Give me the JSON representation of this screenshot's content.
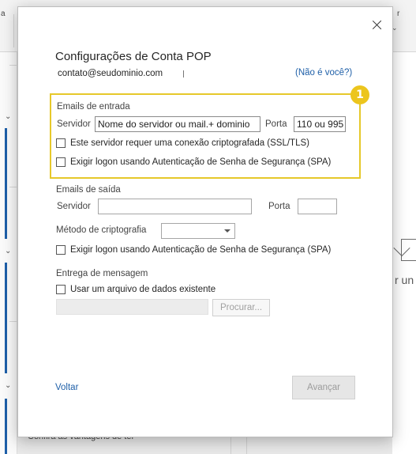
{
  "background": {
    "ribbon_letters": [
      "a",
      "r"
    ],
    "side_text": "r un",
    "bottom_text": "Confira as vantagens de ter"
  },
  "dialog": {
    "title": "Configurações de Conta POP",
    "email": "contato@seudominio.com",
    "not_you_link": "(Não é você?)",
    "badge_number": "1",
    "incoming": {
      "section_label": "Emails de entrada",
      "server_label": "Servidor",
      "server_value": "Nome do servidor ou mail.+ dominio",
      "port_label": "Porta",
      "port_value": "110 ou 995",
      "ssl_label": "Este servidor requer uma conexão criptografada (SSL/TLS)",
      "spa_label": "Exigir logon usando Autenticação de Senha de Segurança (SPA)"
    },
    "outgoing": {
      "section_label": "Emails de saída",
      "server_label": "Servidor",
      "server_value": "",
      "port_label": "Porta",
      "port_value": "",
      "encryption_label": "Método de criptografia",
      "encryption_value": "",
      "spa_label": "Exigir logon usando Autenticação de Senha de Segurança (SPA)"
    },
    "delivery": {
      "section_label": "Entrega de mensagem",
      "existing_file_label": "Usar um arquivo de dados existente",
      "browse_label": "Procurar..."
    },
    "back_label": "Voltar",
    "next_label": "Avançar",
    "colors": {
      "highlight": "#e6c82a",
      "badge": "#ecc51d",
      "link": "#1e5fa8"
    }
  }
}
